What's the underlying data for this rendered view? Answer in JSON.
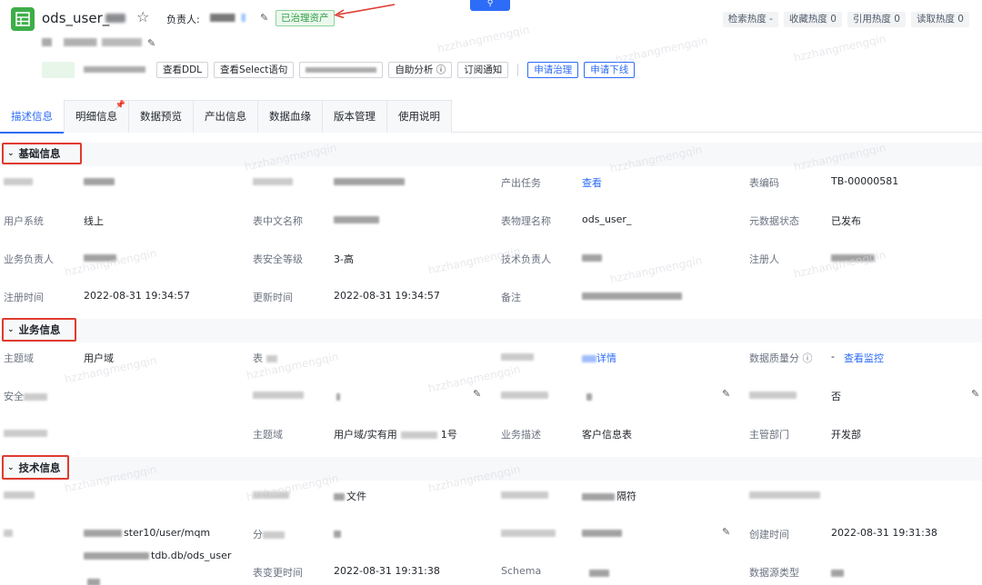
{
  "header": {
    "title": "ods_user_",
    "owner_label": "负责人:",
    "status_tag": "已治理资产",
    "search_label": "⚲",
    "heat": [
      "检索热度 -",
      "收藏热度 0",
      "引用热度 0",
      "读取热度 0"
    ]
  },
  "actions": {
    "view_ddl": "查看DDL",
    "view_select": "查看Select语句",
    "auto_analysis": "自助分析 ⓘ",
    "subscribe": "订阅通知",
    "apply_govern": "申请治理",
    "apply_offline": "申请下线"
  },
  "tabs": [
    "描述信息",
    "明细信息",
    "数据预览",
    "产出信息",
    "数据血缘",
    "版本管理",
    "使用说明"
  ],
  "sections": {
    "basic": "基础信息",
    "business": "业务信息",
    "tech": "技术信息"
  },
  "basic": {
    "r1": {
      "label_task": "产出任务",
      "task_link": "查看",
      "label_code": "表编码",
      "code": "TB-00000581"
    },
    "r2": {
      "label_user_sys": "用户系统",
      "user_sys": "线上",
      "label_cn_name": "表中文名称",
      "label_phys_name": "表物理名称",
      "phys_name": "ods_user_",
      "label_meta_status": "元数据状态",
      "meta_status": "已发布"
    },
    "r3": {
      "label_biz_owner": "业务负责人",
      "label_security": "表安全等级",
      "security": "3-高",
      "label_tech_owner": "技术负责人",
      "label_registrant": "注册人"
    },
    "r4": {
      "label_reg_time": "注册时间",
      "reg_time": "2022-08-31 19:34:57",
      "label_update_time": "更新时间",
      "update_time": "2022-08-31 19:34:57",
      "label_note": "备注"
    }
  },
  "business": {
    "r1": {
      "label_domain": "主题域",
      "domain": "用户域",
      "label_table": "表",
      "detail_link": "详情",
      "label_quality": "数据质量分 ⓘ",
      "quality_value": "-",
      "monitor_link": "查看监控"
    },
    "r2": {
      "label_safety": "安全",
      "value_no": "否"
    },
    "r3": {
      "label_domain2": "主题域",
      "domain2": "用户域/实有用",
      "domain2_suffix": "1号",
      "label_biz_desc": "业务描述",
      "biz_desc": "客户信息表",
      "label_dept": "主管部门",
      "dept": "开发部"
    }
  },
  "tech": {
    "r1": {
      "file_suffix": "文件",
      "delim_suffix": "隔符"
    },
    "r2": {
      "path_mid": "ster10/user/mqm",
      "label_part": "分",
      "label_created": "创建时间",
      "created": "2022-08-31 19:31:38",
      "path2_mid": "tdb.db/ods_user"
    },
    "r3": {
      "label_schema_change": "表变更时间",
      "schema_change": "2022-08-31 19:31:38",
      "label_schema": "Schema",
      "label_ds_type": "数据源类型"
    }
  },
  "watermark": "hzzhangmengqin"
}
